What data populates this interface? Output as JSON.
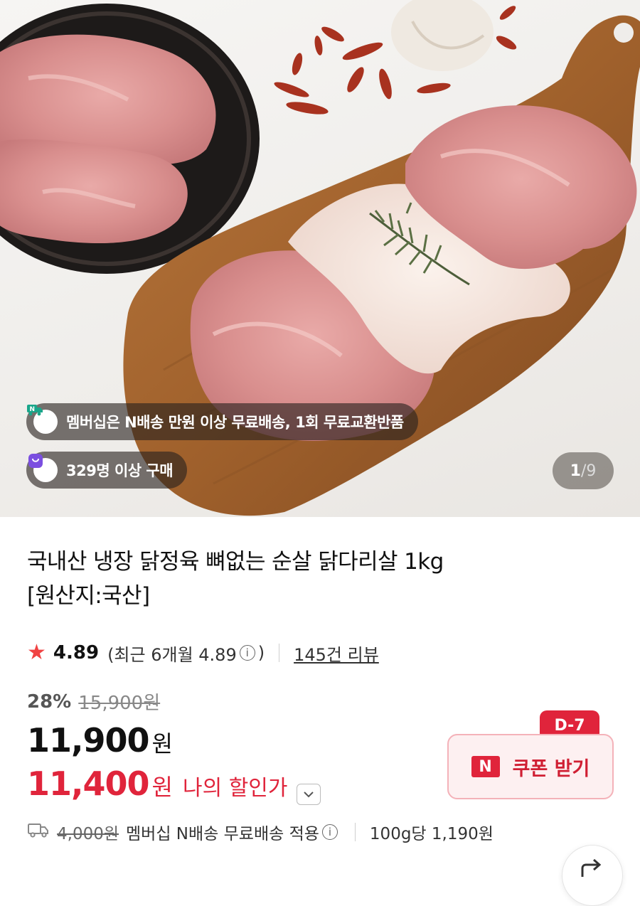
{
  "hero": {
    "delivery_badge": "멤버십은 N배송 만원 이상 무료배송, 1회 무료교환반품",
    "buyers_badge": "329명 이상 구매",
    "image_index": "1",
    "image_sep": "/",
    "image_total": "9",
    "delivery_icon_text": "N"
  },
  "product": {
    "title_line1": "국내산 냉장 닭정육 뼈없는 순살 닭다리살 1kg",
    "title_line2": "[원산지:국산]",
    "rating": "4.89",
    "rating_recent_prefix": "(최근 6개월 4.89",
    "rating_recent_suffix": ")",
    "info_glyph": "i",
    "review_link": "145건 리뷰",
    "discount_percent": "28%",
    "original_price": "15,900원",
    "price": "11,900",
    "price_unit": "원",
    "my_price": "11,400",
    "my_price_unit": "원",
    "my_price_label": "나의 할인가"
  },
  "coupon": {
    "dday": "D-7",
    "n_logo": "N",
    "label": "쿠폰 받기"
  },
  "shipping": {
    "original_fee": "4,000원",
    "text": "멤버십 N배송 무료배송 적용",
    "unit_price": "100g당 1,190원"
  },
  "icons": {
    "star": "star-icon",
    "truck": "truck-icon",
    "share": "share-icon",
    "chevron": "chevron-down-icon"
  },
  "colors": {
    "accent_red": "#e0243b",
    "star_red": "#f04343",
    "buyers_purple": "#7b4fe0",
    "delivery_teal": "#19a68a"
  }
}
